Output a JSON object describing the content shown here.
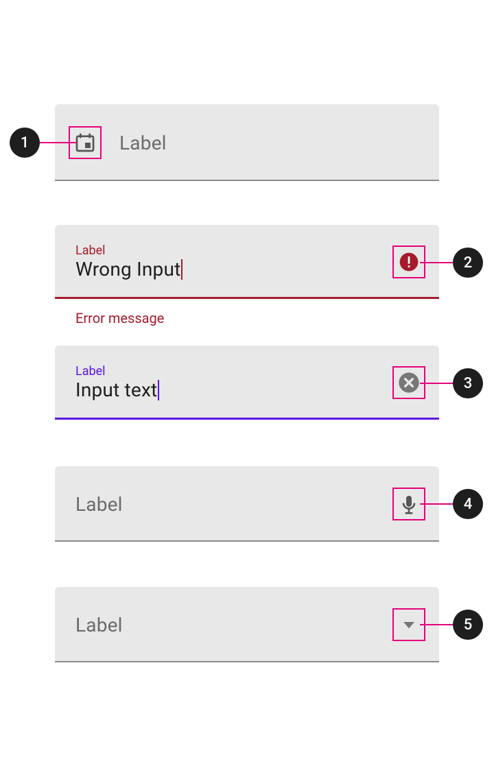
{
  "callouts": {
    "n1": "1",
    "n2": "2",
    "n3": "3",
    "n4": "4",
    "n5": "5"
  },
  "fields": {
    "f1": {
      "label": "Label"
    },
    "f2": {
      "label": "Label",
      "value": "Wrong Input",
      "helper": "Error message"
    },
    "f3": {
      "label": "Label",
      "value": "Input text"
    },
    "f4": {
      "label": "Label"
    },
    "f5": {
      "label": "Label"
    }
  },
  "colors": {
    "error": "#a61b2b",
    "primary": "#5b16e6",
    "highlight": "#e6007a",
    "fieldBg": "#e8e8e8"
  }
}
